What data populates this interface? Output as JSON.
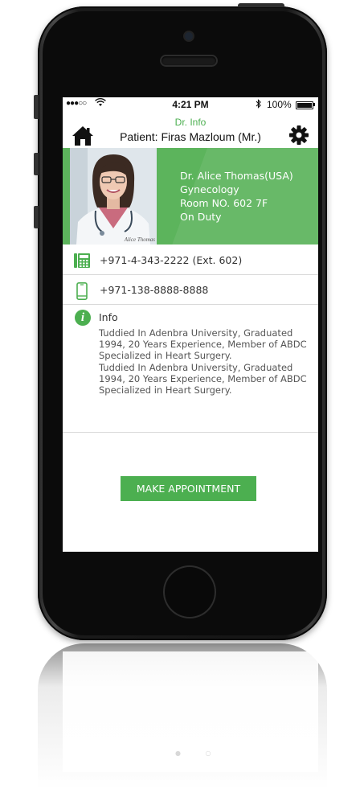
{
  "status_bar": {
    "signal": "●●●○○",
    "time": "4:21 PM",
    "battery": "100%"
  },
  "header": {
    "subtitle": "Dr. Info",
    "title": "Patient: Firas Mazloum (Mr.)"
  },
  "icons": {
    "home": "home-icon",
    "settings": "gear-icon",
    "landline": "landline-phone-icon",
    "mobile": "mobile-phone-icon",
    "info": "info-icon"
  },
  "doctor": {
    "photo_caption": "Alice Thomas",
    "name": "Dr. Alice Thomas(USA)",
    "specialty": "Gynecology",
    "room": "Room NO. 602 7F",
    "status": "On Duty"
  },
  "contacts": {
    "landline": "+971-4-343-2222 (Ext. 602)",
    "mobile": "+971-138-8888-8888"
  },
  "info": {
    "title": "Info",
    "paragraphs": [
      "Tuddied In Adenbra University, Graduated 1994, 20 Years Experience, Member of ABDC Specialized in Heart Surgery.",
      "Tuddied In Adenbra University, Graduated 1994, 20 Years Experience, Member of ABDC Specialized in Heart Surgery."
    ]
  },
  "actions": {
    "make_appointment": "MAKE APPOINTMENT"
  },
  "colors": {
    "accent": "#4caf50",
    "profile_bg": "#5cb45c"
  }
}
